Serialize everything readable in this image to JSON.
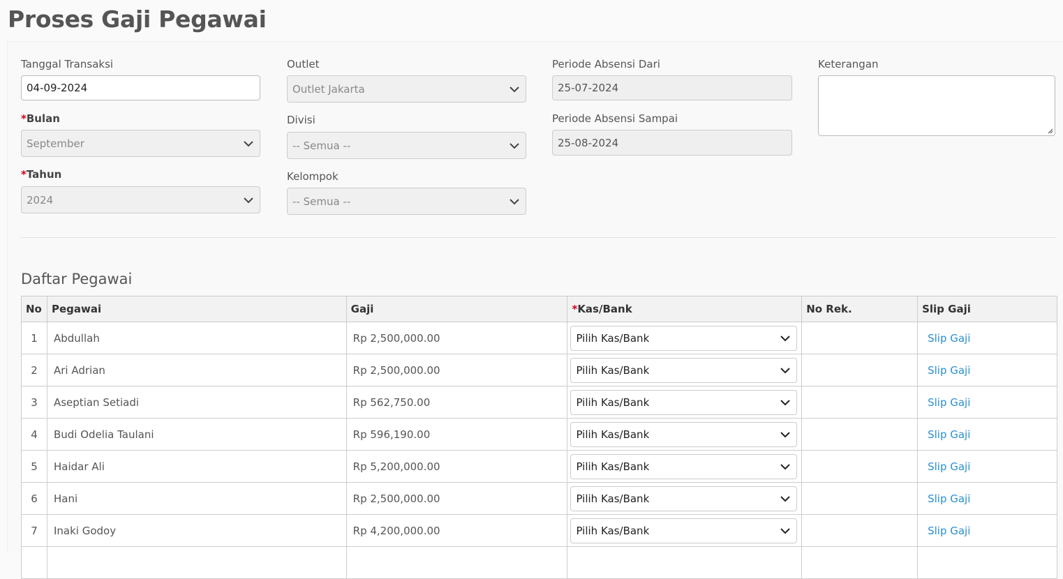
{
  "page": {
    "title": "Proses Gaji Pegawai"
  },
  "form": {
    "tanggal": {
      "label": "Tanggal Transaksi",
      "value": "04-09-2024"
    },
    "bulan": {
      "label": "Bulan",
      "value": "September"
    },
    "tahun": {
      "label": "Tahun",
      "value": "2024"
    },
    "outlet": {
      "label": "Outlet",
      "value": "Outlet Jakarta"
    },
    "divisi": {
      "label": "Divisi",
      "value": "-- Semua --"
    },
    "kelompok": {
      "label": "Kelompok",
      "value": "-- Semua --"
    },
    "periode_dari": {
      "label": "Periode Absensi Dari",
      "value": "25-07-2024"
    },
    "periode_sampai": {
      "label": "Periode Absensi Sampai",
      "value": "25-08-2024"
    },
    "keterangan": {
      "label": "Keterangan",
      "value": ""
    },
    "required_star": "*"
  },
  "table": {
    "title": "Daftar Pegawai",
    "headers": {
      "no": "No",
      "pegawai": "Pegawai",
      "gaji": "Gaji",
      "kasbank": "Kas/Bank",
      "norek": "No Rek.",
      "slip": "Slip Gaji"
    },
    "rows": [
      {
        "no": "1",
        "pegawai": "Abdullah",
        "gaji": "Rp 2,500,000.00",
        "kasbank": "Pilih Kas/Bank",
        "norek": "",
        "slip": "Slip Gaji"
      },
      {
        "no": "2",
        "pegawai": "Ari Adrian",
        "gaji": "Rp 2,500,000.00",
        "kasbank": "Pilih Kas/Bank",
        "norek": "",
        "slip": "Slip Gaji"
      },
      {
        "no": "3",
        "pegawai": "Aseptian Setiadi",
        "gaji": "Rp 562,750.00",
        "kasbank": "Pilih Kas/Bank",
        "norek": "",
        "slip": "Slip Gaji"
      },
      {
        "no": "4",
        "pegawai": "Budi Odelia Taulani",
        "gaji": "Rp 596,190.00",
        "kasbank": "Pilih Kas/Bank",
        "norek": "",
        "slip": "Slip Gaji"
      },
      {
        "no": "5",
        "pegawai": "Haidar Ali",
        "gaji": "Rp 5,200,000.00",
        "kasbank": "Pilih Kas/Bank",
        "norek": "",
        "slip": "Slip Gaji"
      },
      {
        "no": "6",
        "pegawai": "Hani",
        "gaji": "Rp 2,500,000.00",
        "kasbank": "Pilih Kas/Bank",
        "norek": "",
        "slip": "Slip Gaji"
      },
      {
        "no": "7",
        "pegawai": "Inaki Godoy",
        "gaji": "Rp 4,200,000.00",
        "kasbank": "Pilih Kas/Bank",
        "norek": "",
        "slip": "Slip Gaji"
      },
      {
        "no": "",
        "pegawai": "",
        "gaji": "",
        "kasbank": "",
        "norek": "",
        "slip": ""
      }
    ]
  },
  "colors": {
    "link": "#2a8fd0",
    "required": "#d0021b"
  },
  "icons": {
    "select": "chevron-down-icon",
    "textarea": "resize-handle-icon"
  }
}
